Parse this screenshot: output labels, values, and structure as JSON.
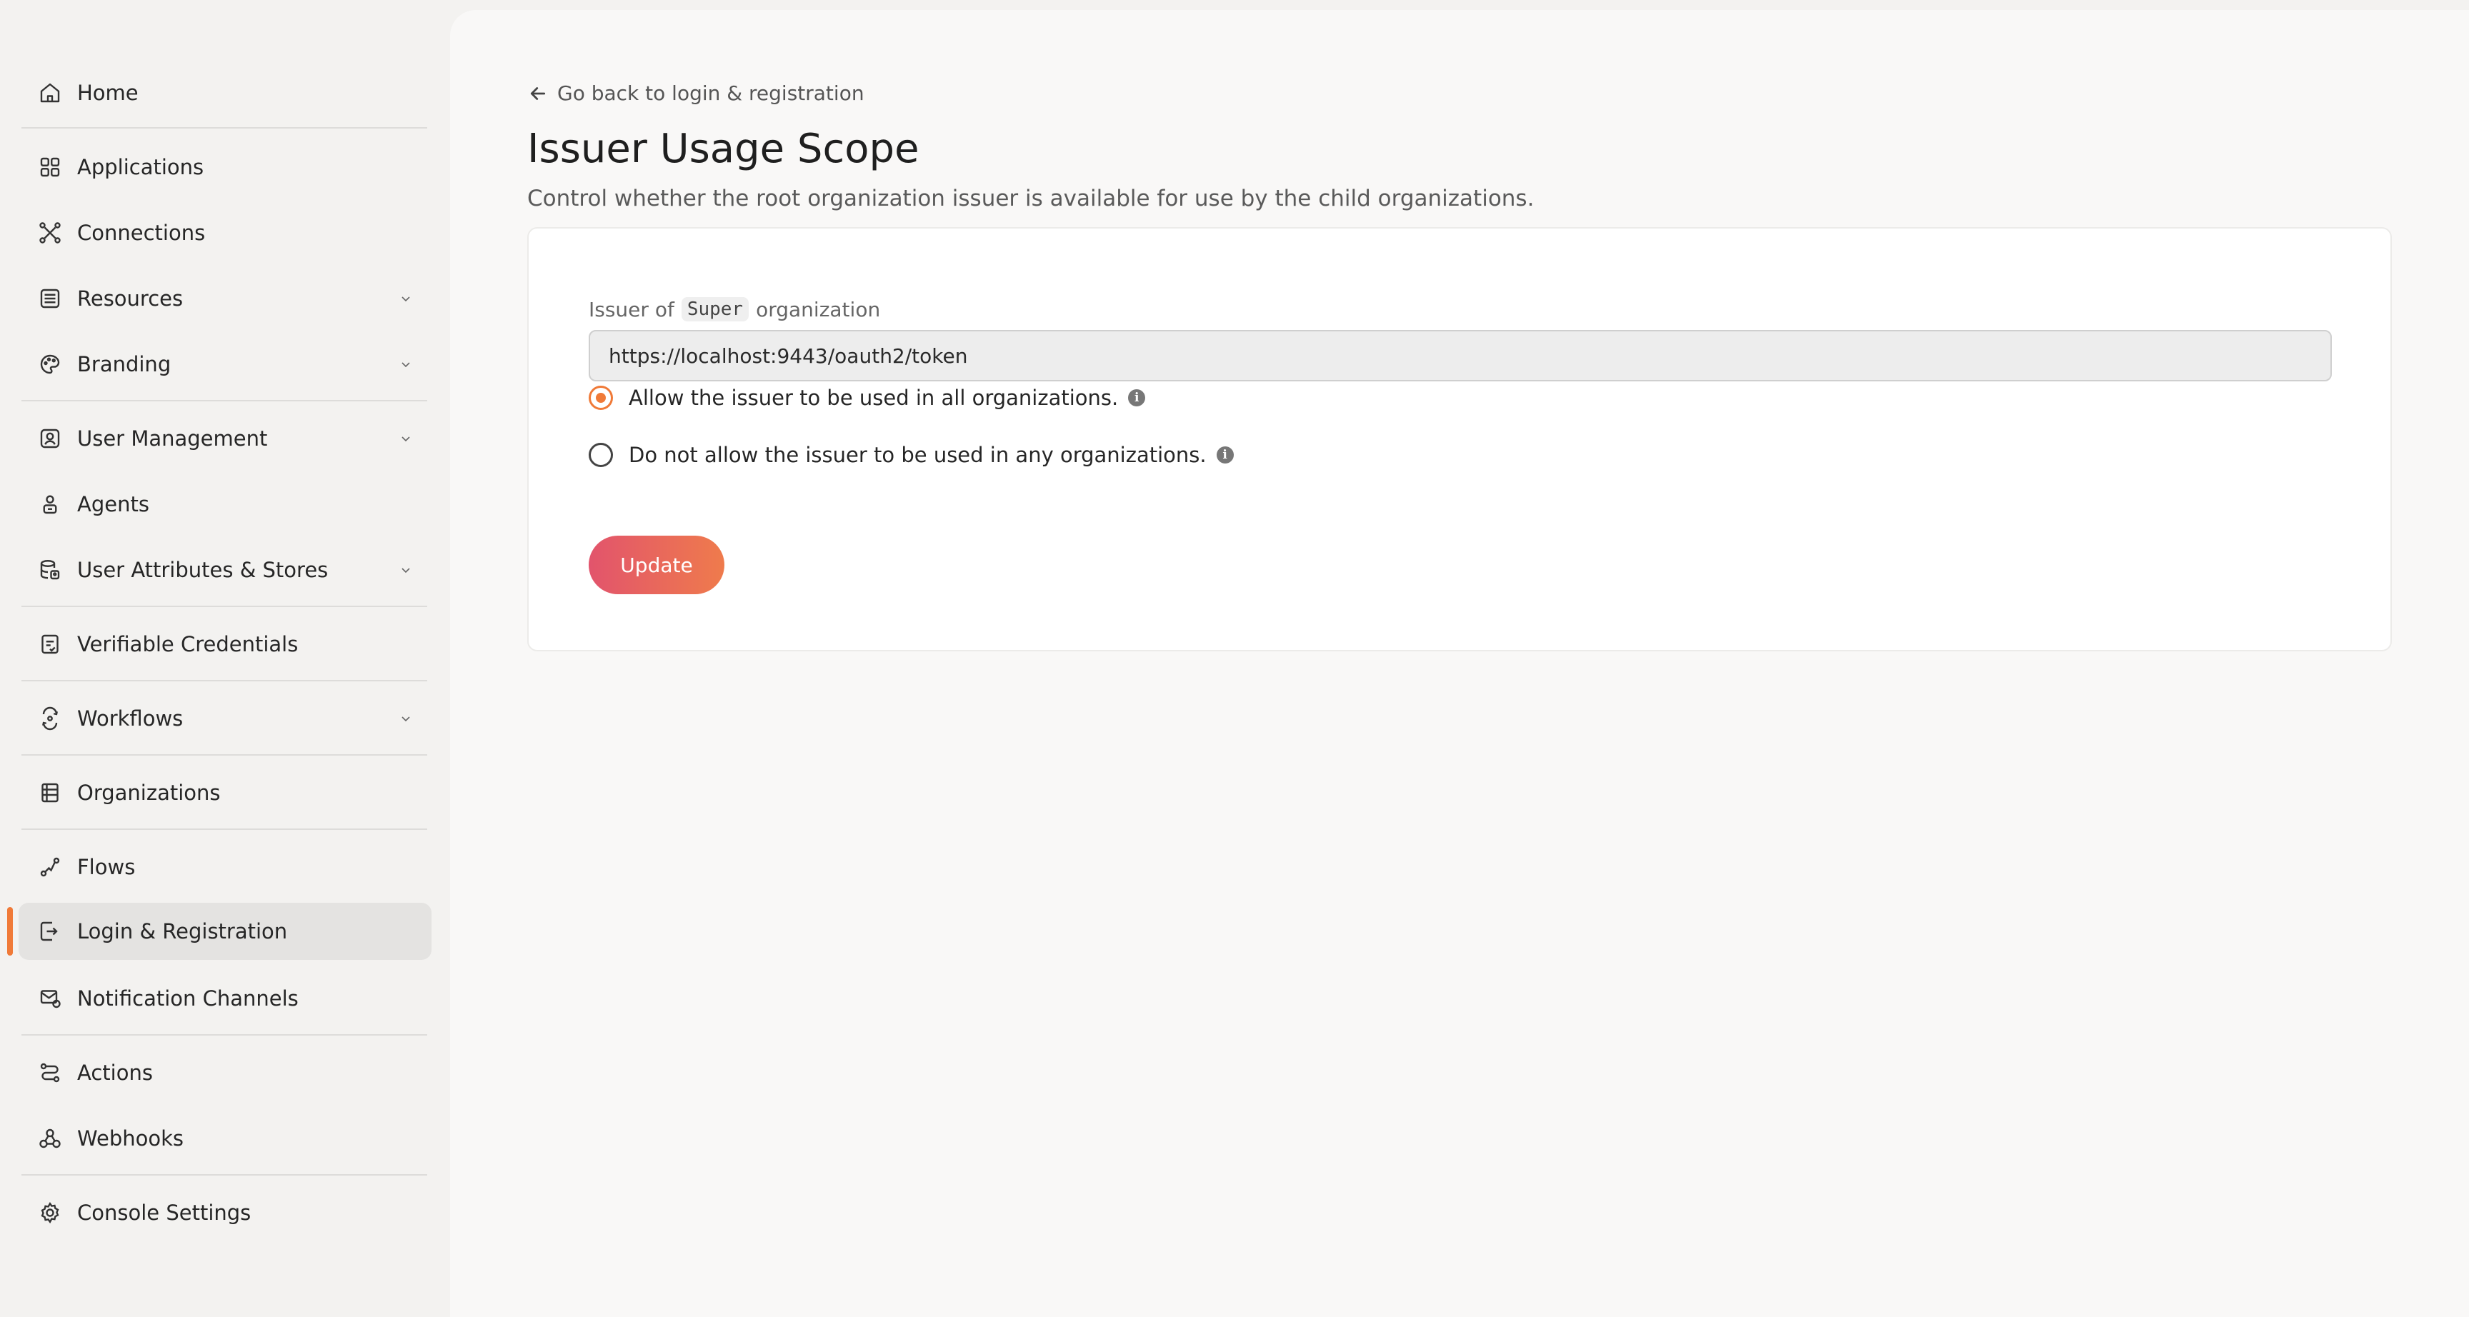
{
  "sidebar": {
    "items": [
      {
        "label": "Home",
        "icon": "home-icon"
      },
      {
        "label": "Applications",
        "icon": "applications-icon"
      },
      {
        "label": "Connections",
        "icon": "connections-icon"
      },
      {
        "label": "Resources",
        "icon": "resources-icon",
        "expandable": true
      },
      {
        "label": "Branding",
        "icon": "branding-icon",
        "expandable": true
      },
      {
        "label": "User Management",
        "icon": "user-management-icon",
        "expandable": true
      },
      {
        "label": "Agents",
        "icon": "agents-icon"
      },
      {
        "label": "User Attributes & Stores",
        "icon": "user-attributes-icon",
        "expandable": true
      },
      {
        "label": "Verifiable Credentials",
        "icon": "verifiable-credentials-icon"
      },
      {
        "label": "Workflows",
        "icon": "workflows-icon",
        "expandable": true
      },
      {
        "label": "Organizations",
        "icon": "organizations-icon"
      },
      {
        "label": "Flows",
        "icon": "flows-icon"
      },
      {
        "label": "Login & Registration",
        "icon": "login-registration-icon",
        "active": true
      },
      {
        "label": "Notification Channels",
        "icon": "notification-channels-icon"
      },
      {
        "label": "Actions",
        "icon": "actions-icon"
      },
      {
        "label": "Webhooks",
        "icon": "webhooks-icon"
      },
      {
        "label": "Console Settings",
        "icon": "console-settings-icon"
      }
    ]
  },
  "main": {
    "back_link": "Go back to login & registration",
    "title": "Issuer Usage Scope",
    "description": "Control whether the root organization issuer is available for use by the child organizations.",
    "issuer_field": {
      "label_prefix": "Issuer of",
      "label_code": "Super",
      "label_suffix": "organization",
      "value": "https://localhost:9443/oauth2/token"
    },
    "options": [
      {
        "label": "Allow the issuer to be used in all organizations.",
        "checked": true
      },
      {
        "label": "Do not allow the issuer to be used in any organizations.",
        "checked": false
      }
    ],
    "update_label": "Update"
  },
  "colors": {
    "accent": "#f07a38",
    "button_gradient_start": "#e2546c",
    "button_gradient_end": "#ef7b4c"
  }
}
